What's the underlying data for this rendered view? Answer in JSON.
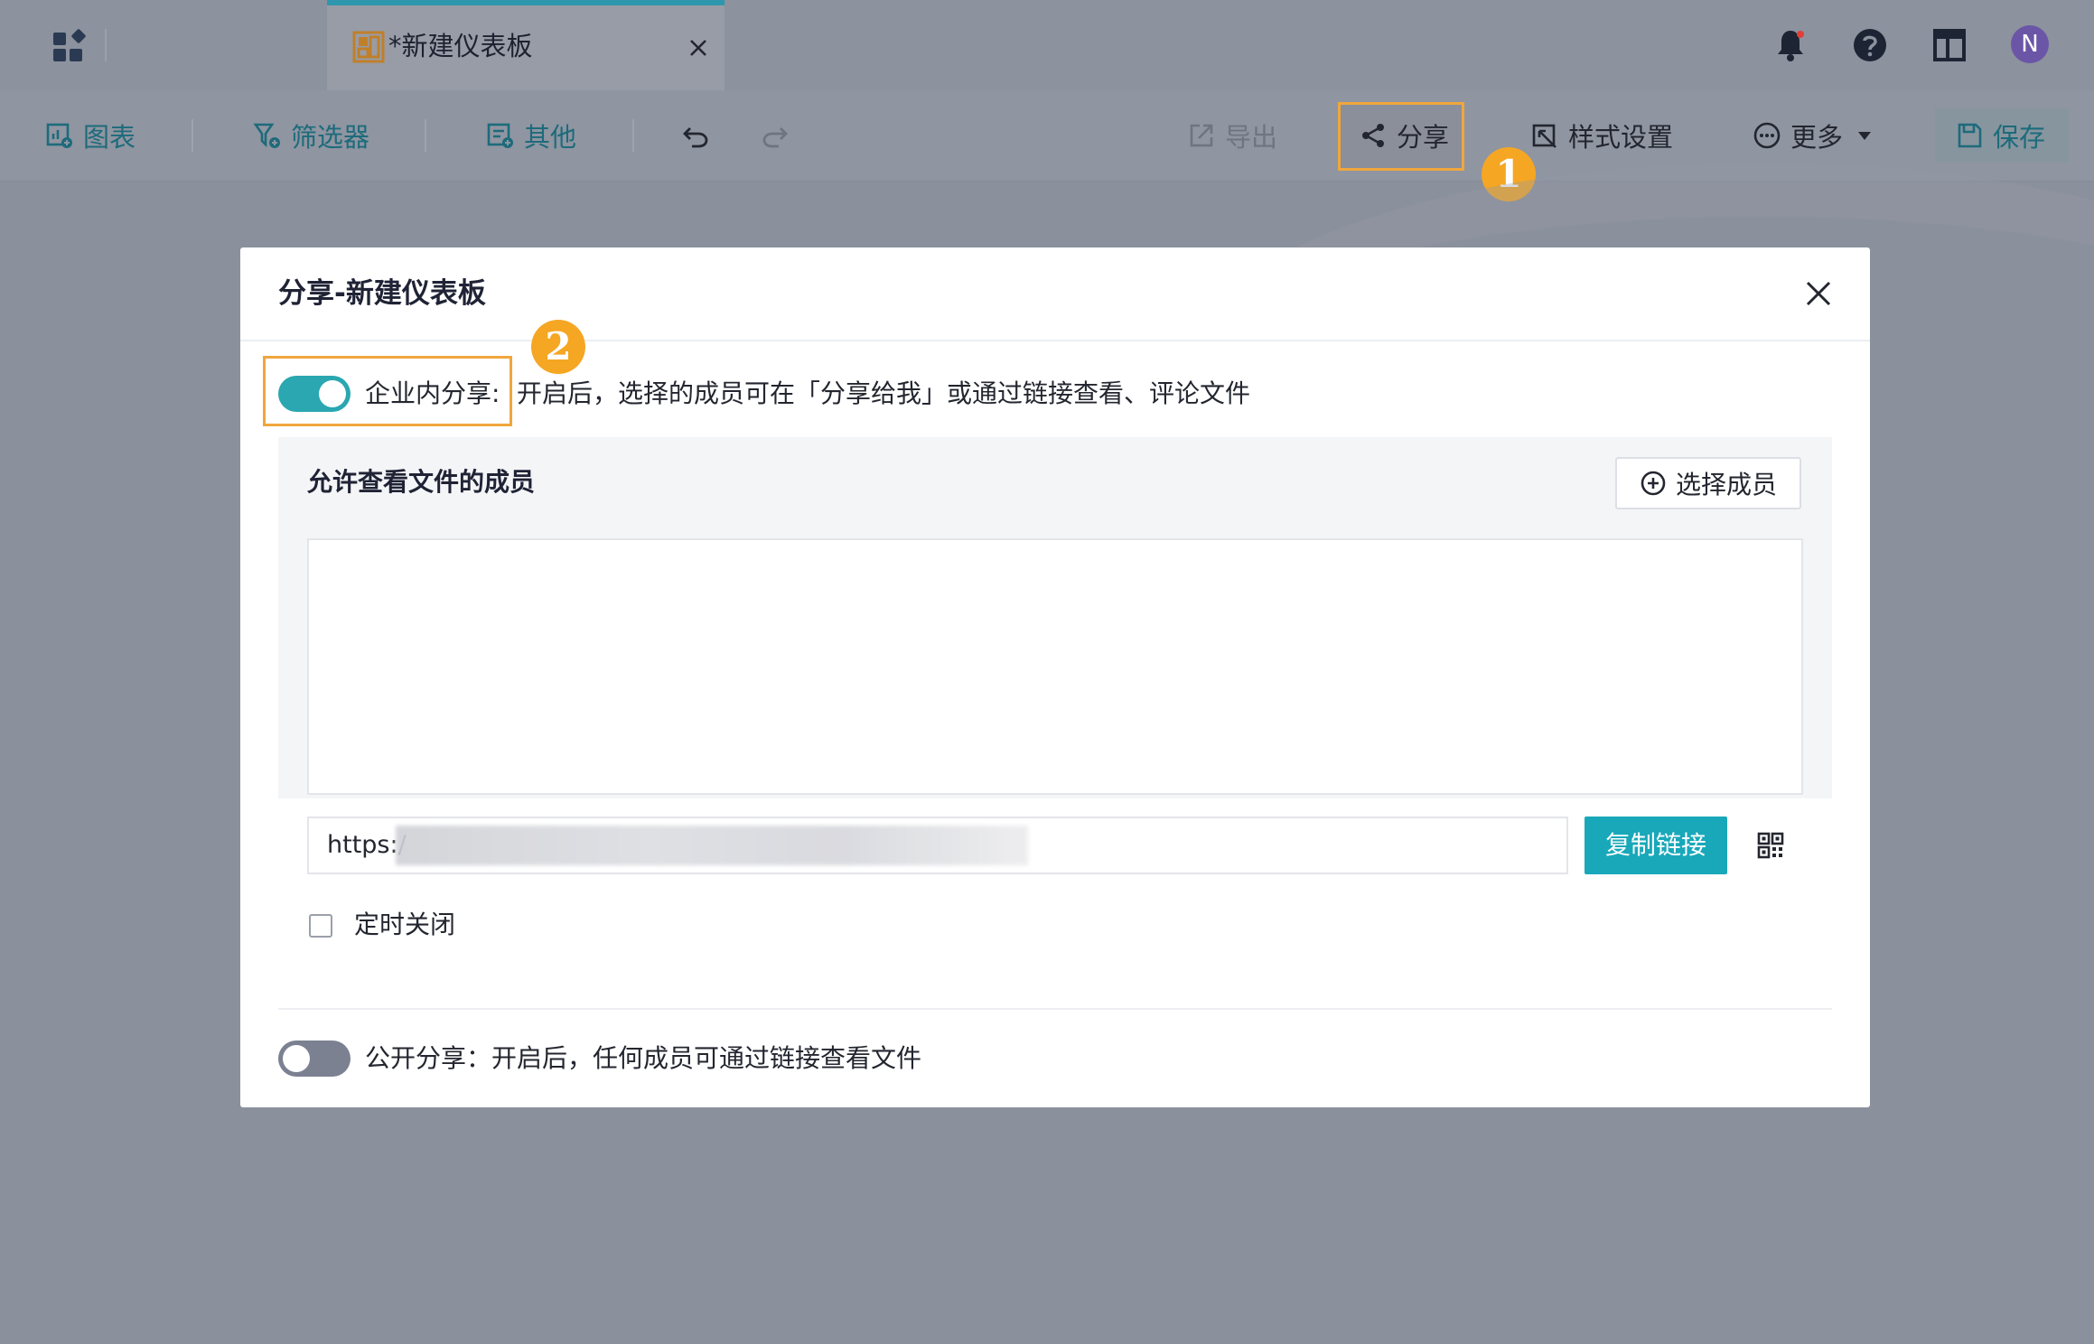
{
  "tab": {
    "title": "*新建仪表板"
  },
  "avatar": {
    "initial": "N"
  },
  "toolbar": {
    "chart": "图表",
    "filter": "筛选器",
    "other": "其他",
    "export": "导出",
    "share": "分享",
    "style_settings": "样式设置",
    "more": "更多",
    "save": "保存"
  },
  "annotations": {
    "badge1": "1",
    "badge2": "2"
  },
  "modal": {
    "title": "分享-新建仪表板",
    "internal_share": {
      "label": "企业内分享:",
      "enabled": true,
      "description": "开启后，选择的成员可在「分享给我」或通过链接查看、评论文件"
    },
    "members": {
      "title": "允许查看文件的成员",
      "select_button": "选择成员"
    },
    "link": {
      "prefix": "https:/",
      "copy_button": "复制链接"
    },
    "timed_close": {
      "label": "定时关闭",
      "checked": false
    },
    "public_share": {
      "enabled": false,
      "text": "公开分享：开启后，任何成员可通过链接查看文件"
    }
  },
  "colors": {
    "accent": "#2aa7b0",
    "copy_button": "#19a8ba",
    "highlight": "#f0a63c",
    "badge": "#f5a623"
  }
}
